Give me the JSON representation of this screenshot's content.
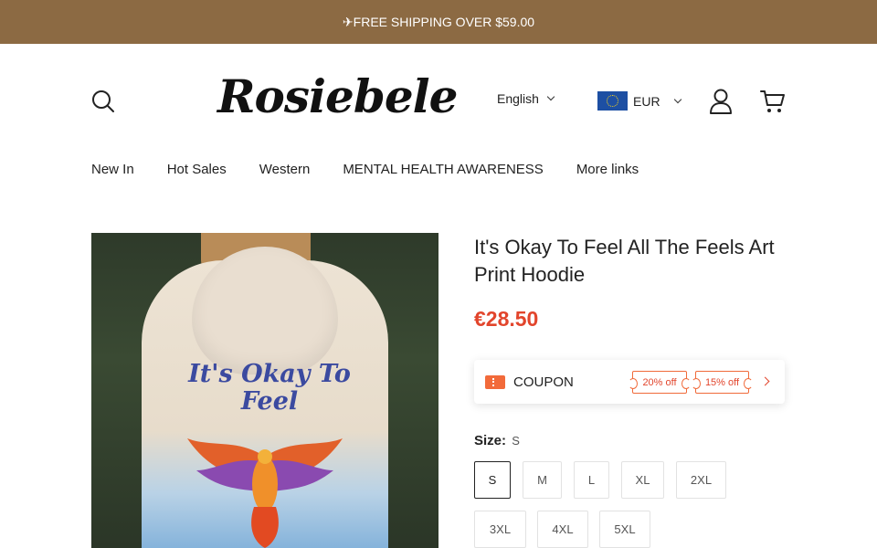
{
  "announcement": {
    "text": "✈FREE SHIPPING OVER $59.00"
  },
  "header": {
    "logo": "Rosiebele",
    "language": "English",
    "currency": "EUR",
    "icons": [
      "search-icon",
      "user-icon",
      "cart-icon",
      "eu-flag-icon"
    ]
  },
  "nav": {
    "items": [
      "New In",
      "Hot Sales",
      "Western",
      "MENTAL HEALTH AWARENESS",
      "More links"
    ]
  },
  "product": {
    "title": "It's Okay To Feel All The Feels Art Print Hoodie",
    "price": "€28.50",
    "image_print_text": "It's Okay To Feel"
  },
  "coupon": {
    "label": "COUPON",
    "offers": [
      "20% off",
      "15% off"
    ],
    "accent": "#f06a3a"
  },
  "sizes": {
    "label": "Size:",
    "selected": "S",
    "options": [
      "S",
      "M",
      "L",
      "XL",
      "2XL",
      "3XL",
      "4XL",
      "5XL"
    ]
  },
  "colors": {
    "announcement_bg": "#8c6a43",
    "price": "#e2452c"
  }
}
